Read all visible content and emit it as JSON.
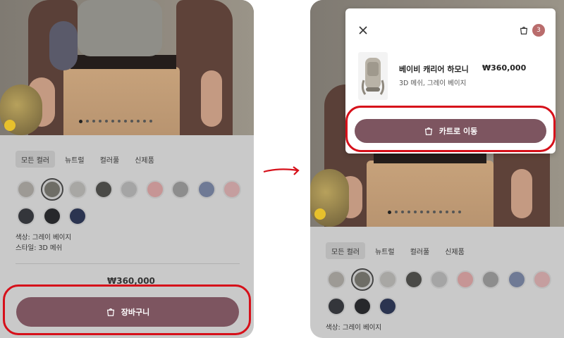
{
  "left": {
    "chips": [
      "모든 컬러",
      "뉴트럴",
      "컬러풀",
      "신제품"
    ],
    "swatch_colors": [
      "#9d9a95",
      "#6e6d66",
      "#a8a7a4",
      "#4a4a47",
      "#a5a5a5",
      "#c69595",
      "#8d8d8d",
      "#6f7a95",
      "#c59e9f",
      "#34363b",
      "#27282b",
      "#2b3450"
    ],
    "meta_color_label": "색상: 그레이 베이지",
    "meta_style_label": "스타일: 3D 메쉬",
    "price": "₩360,000",
    "cart_button_label": "장바구니"
  },
  "right": {
    "chips": [
      "모든 컬러",
      "뉴트럴",
      "컬러풀",
      "신제품"
    ],
    "swatch_colors": [
      "#9d9a95",
      "#6e6d66",
      "#a8a7a4",
      "#4a4a47",
      "#a5a5a5",
      "#c69595",
      "#8d8d8d",
      "#6f7a95",
      "#c59e9f",
      "#34363b",
      "#27282b",
      "#2b3450"
    ],
    "meta_color_label": "색상: 그레이 베이지",
    "popup": {
      "badge_count": "3",
      "product_name": "베이비 캐리어 하모니",
      "product_price": "₩360,000",
      "product_options": "3D 메쉬, 그레이 베이지",
      "go_to_cart_label": "카트로 이동"
    }
  }
}
